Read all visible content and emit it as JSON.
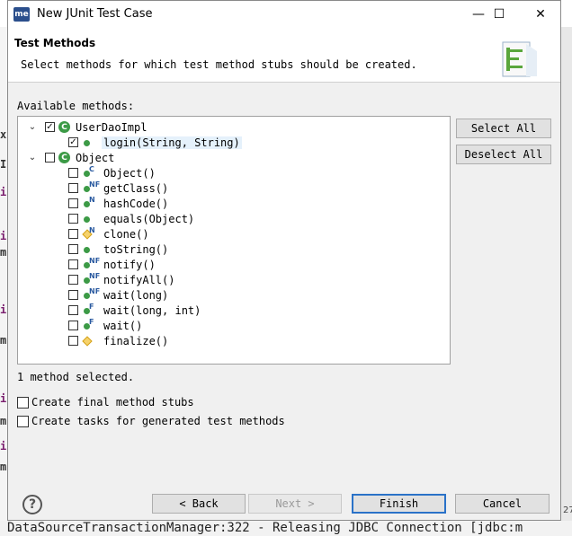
{
  "window": {
    "app_icon_text": "me",
    "title": "New JUnit Test Case",
    "minimize_glyph": "—",
    "maximize_glyph": "☐",
    "close_glyph": "✕"
  },
  "header": {
    "title": "Test Methods",
    "description": "Select methods for which test method stubs should be created."
  },
  "available_label": "Available methods:",
  "tree": [
    {
      "label": "UserDaoImpl",
      "checked": true,
      "expanded": true,
      "level": 0,
      "icon": "class-icon"
    },
    {
      "label": "login(String, String)",
      "checked": true,
      "level": 1,
      "icon": "public-method-icon",
      "modifiers": "",
      "selected": true
    },
    {
      "label": "Object",
      "checked": false,
      "expanded": true,
      "level": 0,
      "icon": "class-icon"
    },
    {
      "label": "Object()",
      "checked": false,
      "level": 1,
      "icon": "public-method-icon",
      "modifiers": "C"
    },
    {
      "label": "getClass()",
      "checked": false,
      "level": 1,
      "icon": "public-method-icon",
      "modifiers": "NF"
    },
    {
      "label": "hashCode()",
      "checked": false,
      "level": 1,
      "icon": "public-method-icon",
      "modifiers": "N"
    },
    {
      "label": "equals(Object)",
      "checked": false,
      "level": 1,
      "icon": "public-method-icon",
      "modifiers": ""
    },
    {
      "label": "clone()",
      "checked": false,
      "level": 1,
      "icon": "protected-method-icon",
      "modifiers": "N"
    },
    {
      "label": "toString()",
      "checked": false,
      "level": 1,
      "icon": "public-method-icon",
      "modifiers": ""
    },
    {
      "label": "notify()",
      "checked": false,
      "level": 1,
      "icon": "public-method-icon",
      "modifiers": "NF"
    },
    {
      "label": "notifyAll()",
      "checked": false,
      "level": 1,
      "icon": "public-method-icon",
      "modifiers": "NF"
    },
    {
      "label": "wait(long)",
      "checked": false,
      "level": 1,
      "icon": "public-method-icon",
      "modifiers": "NF"
    },
    {
      "label": "wait(long, int)",
      "checked": false,
      "level": 1,
      "icon": "public-method-icon",
      "modifiers": "F"
    },
    {
      "label": "wait()",
      "checked": false,
      "level": 1,
      "icon": "public-method-icon",
      "modifiers": "F"
    },
    {
      "label": "finalize()",
      "checked": false,
      "level": 1,
      "icon": "protected-method-icon",
      "modifiers": ""
    }
  ],
  "buttons": {
    "select_all": "Select All",
    "deselect_all": "Deselect All",
    "back": "< Back",
    "next": "Next >",
    "finish": "Finish",
    "cancel": "Cancel"
  },
  "status": "1 method selected.",
  "options": {
    "final_stubs": "Create final method stubs",
    "tasks": "Create tasks for generated test methods"
  },
  "help_glyph": "?",
  "background": {
    "bottom_log": "DataSourceTransactionManager:322 - Releasing JDBC Connection [jdbc:m",
    "side_chars": [
      "x",
      "I",
      "i",
      "i",
      "m",
      "i",
      "m",
      "i",
      "m",
      "i",
      "m"
    ],
    "right_text": "27"
  },
  "colors": {
    "accent": "#2a72c8",
    "selection": "#e5f1fb",
    "method_green": "#3c9a46",
    "protected_yellow": "#f6d26b"
  }
}
